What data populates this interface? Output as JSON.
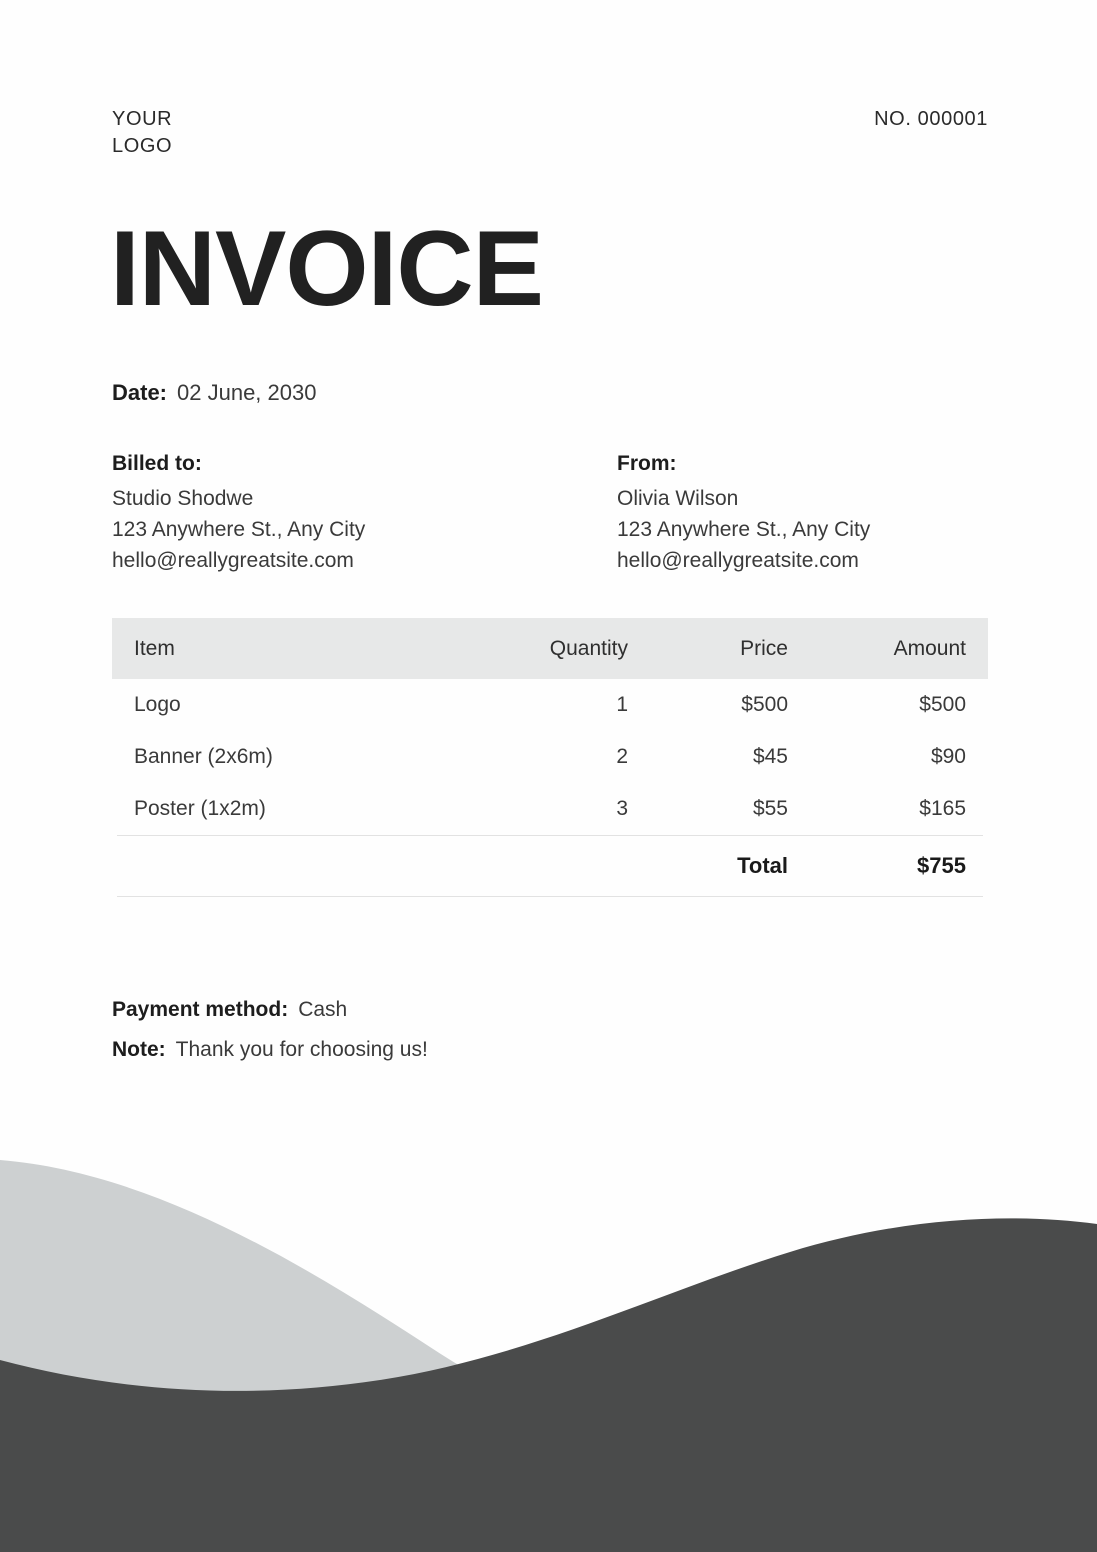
{
  "header": {
    "logo_line1": "YOUR",
    "logo_line2": "LOGO",
    "invoice_number": "NO. 000001"
  },
  "title": "INVOICE",
  "date": {
    "label": "Date:",
    "value": "02 June, 2030"
  },
  "billed_to": {
    "label": "Billed to:",
    "name": "Studio Shodwe",
    "address": "123 Anywhere St., Any City",
    "email": "hello@reallygreatsite.com"
  },
  "from": {
    "label": "From:",
    "name": "Olivia Wilson",
    "address": "123 Anywhere St., Any City",
    "email": "hello@reallygreatsite.com"
  },
  "table": {
    "columns": {
      "item": "Item",
      "quantity": "Quantity",
      "price": "Price",
      "amount": "Amount"
    },
    "rows": [
      {
        "item": "Logo",
        "quantity": "1",
        "price": "$500",
        "amount": "$500"
      },
      {
        "item": "Banner (2x6m)",
        "quantity": "2",
        "price": "$45",
        "amount": "$90"
      },
      {
        "item": "Poster (1x2m)",
        "quantity": "3",
        "price": "$55",
        "amount": "$165"
      }
    ],
    "total_label": "Total",
    "total_value": "$755"
  },
  "footer": {
    "payment_label": "Payment method:",
    "payment_value": "Cash",
    "note_label": "Note:",
    "note_value": "Thank you for choosing us!"
  },
  "colors": {
    "page_background": "#fefefe",
    "title_text": "#212121",
    "table_header_background": "#e7e8e8",
    "rule": "#e2e2e2",
    "wave_light": "#cdd0d1",
    "wave_dark": "#4a4b4b"
  }
}
